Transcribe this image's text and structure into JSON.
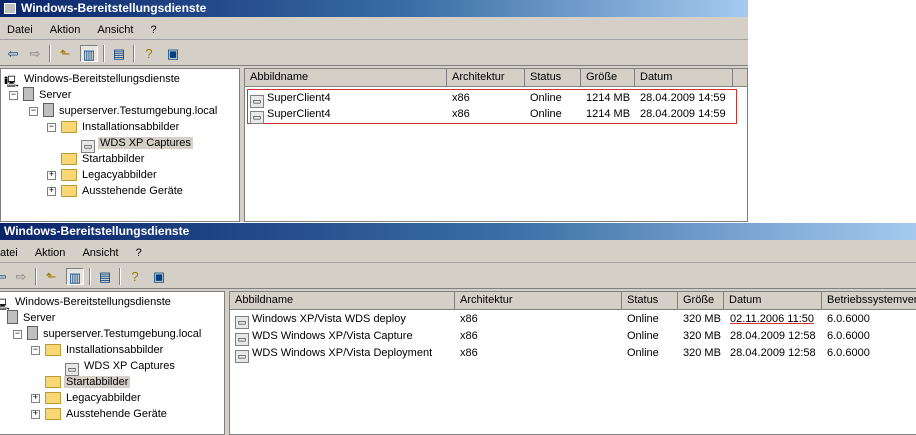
{
  "top": {
    "title": "Windows-Bereitstellungsdienste",
    "menu": [
      "Datei",
      "Aktion",
      "Ansicht",
      "?"
    ],
    "tree": {
      "root": "Windows-Bereitstellungsdienste",
      "server": "Server",
      "host": "superserver.Testumgebung.local",
      "install": "Installationsabbilder",
      "captures": "WDS XP Captures",
      "boot": "Startabbilder",
      "legacy": "Legacyabbilder",
      "pending": "Ausstehende Geräte"
    },
    "columns": [
      "Abbildname",
      "Architektur",
      "Status",
      "Größe",
      "Datum"
    ],
    "rows": [
      {
        "name": "SuperClient4",
        "arch": "x86",
        "status": "Online",
        "size": "1214 MB",
        "date": "28.04.2009 14:59"
      },
      {
        "name": "SuperClient4",
        "arch": "x86",
        "status": "Online",
        "size": "1214 MB",
        "date": "28.04.2009 14:59"
      }
    ]
  },
  "bottom": {
    "title": "Windows-Bereitstellungsdienste",
    "menu": [
      "atei",
      "Aktion",
      "Ansicht",
      "?"
    ],
    "tree": {
      "root": "Windows-Bereitstellungsdienste",
      "server": "Server",
      "host": "superserver.Testumgebung.local",
      "install": "Installationsabbilder",
      "captures": "WDS XP Captures",
      "boot": "Startabbilder",
      "legacy": "Legacyabbilder",
      "pending": "Ausstehende Geräte"
    },
    "columns": [
      "Abbildname",
      "Architektur",
      "Status",
      "Größe",
      "Datum",
      "Betriebssystemvers"
    ],
    "rows": [
      {
        "name": "Windows XP/Vista WDS deploy",
        "arch": "x86",
        "status": "Online",
        "size": "320 MB",
        "date": "02.11.2006 11:50",
        "os": "6.0.6000"
      },
      {
        "name": "WDS Windows XP/Vista Capture",
        "arch": "x86",
        "status": "Online",
        "size": "320 MB",
        "date": "28.04.2009 12:58",
        "os": "6.0.6000"
      },
      {
        "name": "WDS Windows XP/Vista Deployment",
        "arch": "x86",
        "status": "Online",
        "size": "320 MB",
        "date": "28.04.2009 12:58",
        "os": "6.0.6000"
      }
    ]
  }
}
